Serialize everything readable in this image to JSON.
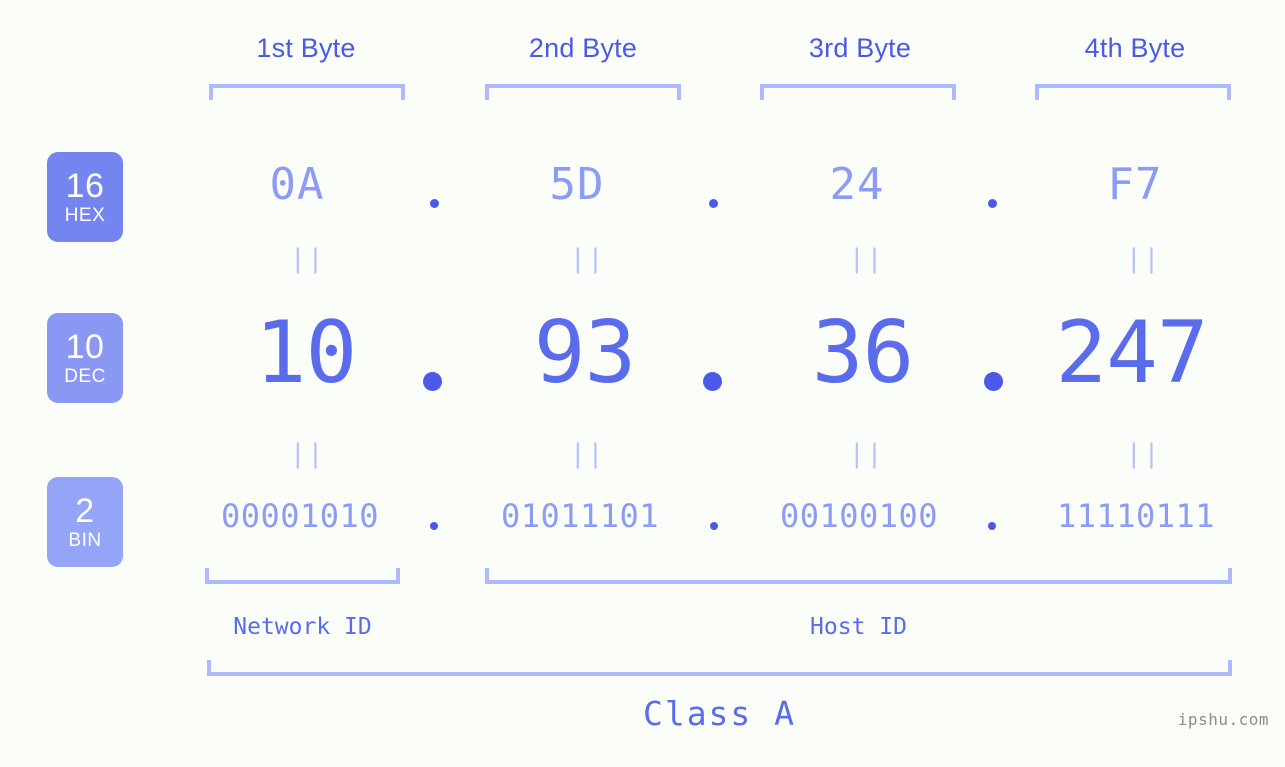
{
  "background_color": "#fbfdf8",
  "accent_colors": {
    "strong_blue": "#4b5ae6",
    "mid_blue": "#5a6cec",
    "light_blue": "#8c9bf5",
    "bracket_blue": "#aebafb",
    "eq_blue": "#b7c1fb"
  },
  "byte_headers": [
    {
      "label": "1st Byte"
    },
    {
      "label": "2nd Byte"
    },
    {
      "label": "3rd Byte"
    },
    {
      "label": "4th Byte"
    }
  ],
  "bases": [
    {
      "number": "16",
      "name": "HEX",
      "color": "#7585ef"
    },
    {
      "number": "10",
      "name": "DEC",
      "color": "#8a98f4"
    },
    {
      "number": "2",
      "name": "BIN",
      "color": "#94a4f7"
    }
  ],
  "rows": {
    "hex": {
      "values": [
        "0A",
        "5D",
        "24",
        "F7"
      ],
      "separator": "."
    },
    "dec": {
      "values": [
        "10",
        "93",
        "36",
        "247"
      ],
      "separator": "."
    },
    "bin": {
      "values": [
        "00001010",
        "01011101",
        "00100100",
        "11110111"
      ],
      "separator": "."
    }
  },
  "equal_marks": {
    "glyph": "||",
    "count_per_row": 4
  },
  "sections": [
    {
      "label": "Network ID"
    },
    {
      "label": "Host ID"
    }
  ],
  "class": {
    "label": "Class A"
  },
  "watermark": {
    "text": "ipshu.com"
  }
}
